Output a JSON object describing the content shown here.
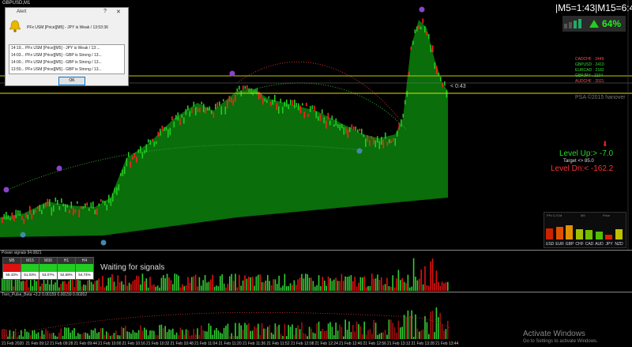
{
  "chart": {
    "symbol_label": "GBPUSD,M1",
    "timer": "|M5=1:43|M15=6:43",
    "trend_pct": "64%",
    "pairs": [
      {
        "label": "CADCHF · 2449",
        "color": "#ff5050"
      },
      {
        "label": "GBPUSD · 2410",
        "color": "#33dd33"
      },
      {
        "label": "EURCAD · 2182",
        "color": "#33dd33"
      },
      {
        "label": "GBPJPY · 2104",
        "color": "#33dd33"
      },
      {
        "label": "AUDCHF · 2021",
        "color": "#ff5050"
      }
    ],
    "watermark": "PSA ©2015 hanover",
    "price_bubble": "< 0:43",
    "level_up": "Level Up:> -7.0",
    "target": "Target <> 85.0",
    "level_dn": "Level Dn:< -162.2",
    "colors": {
      "bull": "#22cc22",
      "bear": "#ff2020",
      "fill": "#0a6e0a"
    }
  },
  "strength_panel": {
    "title": "PFx U.S.M",
    "col_a": "M5",
    "col_b": "Price",
    "currencies": [
      "USD",
      "EUR",
      "GBP",
      "CHF",
      "CAD",
      "AUD",
      "JPY",
      "NZD"
    ],
    "levels": [
      0.55,
      0.6,
      0.7,
      0.5,
      0.45,
      0.4,
      0.25,
      0.5
    ],
    "colors": [
      "#cc2200",
      "#e05000",
      "#e09000",
      "#a0c000",
      "#70c000",
      "#50c000",
      "#e02000",
      "#c0c000"
    ]
  },
  "alert": {
    "title": "Alert",
    "help": "?",
    "close": "✕",
    "message": "PFx USM [Price][M5] - JPY is Weak / 13:53:36",
    "rows": [
      "14:19... PFx USM [Price][M5] - JPY is Weak / 13:...",
      "14:03... PFx USM [Price][M5] - GBP is Strong / 13...",
      "14:00... PFx USM [Price][M5] - GBP is Strong / 13...",
      "13:50... PFx USM [Price][M5] - GBP is Strong / 13..."
    ],
    "ok": "OK"
  },
  "power_panel": {
    "label": "Power signals 94.0821",
    "waiting": "Waiting for signals",
    "timeframes": [
      {
        "name": "M5",
        "pct": "55.43%",
        "color": "#e01010"
      },
      {
        "name": "M15",
        "pct": "51.03%",
        "color": "#22cc22"
      },
      {
        "name": "M30",
        "pct": "53.07%",
        "color": "#22cc22"
      },
      {
        "name": "H1",
        "pct": "52.69%",
        "color": "#22cc22"
      },
      {
        "name": "H4",
        "pct": "54.74%",
        "color": "#22cc22"
      }
    ]
  },
  "pulse_panel": {
    "label": "Tren_Pulse_Beta +3.2 0.00159 0.00159 0.00202"
  },
  "x_axis": [
    "21 Feb 2020",
    "21 Feb 09:12",
    "21 Feb 09:28",
    "21 Feb 09:44",
    "21 Feb 10:00",
    "21 Feb 10:16",
    "21 Feb 10:32",
    "21 Feb 10:48",
    "21 Feb 11:04",
    "21 Feb 11:20",
    "21 Feb 11:36",
    "21 Feb 11:52",
    "21 Feb 12:08",
    "21 Feb 12:24",
    "21 Feb 12:40",
    "21 Feb 12:56",
    "21 Feb 13:12",
    "21 Feb 13:28",
    "21 Feb 13:44"
  ],
  "windows": {
    "title": "Activate Windows",
    "subtitle": "Go to Settings to activate Windows."
  }
}
